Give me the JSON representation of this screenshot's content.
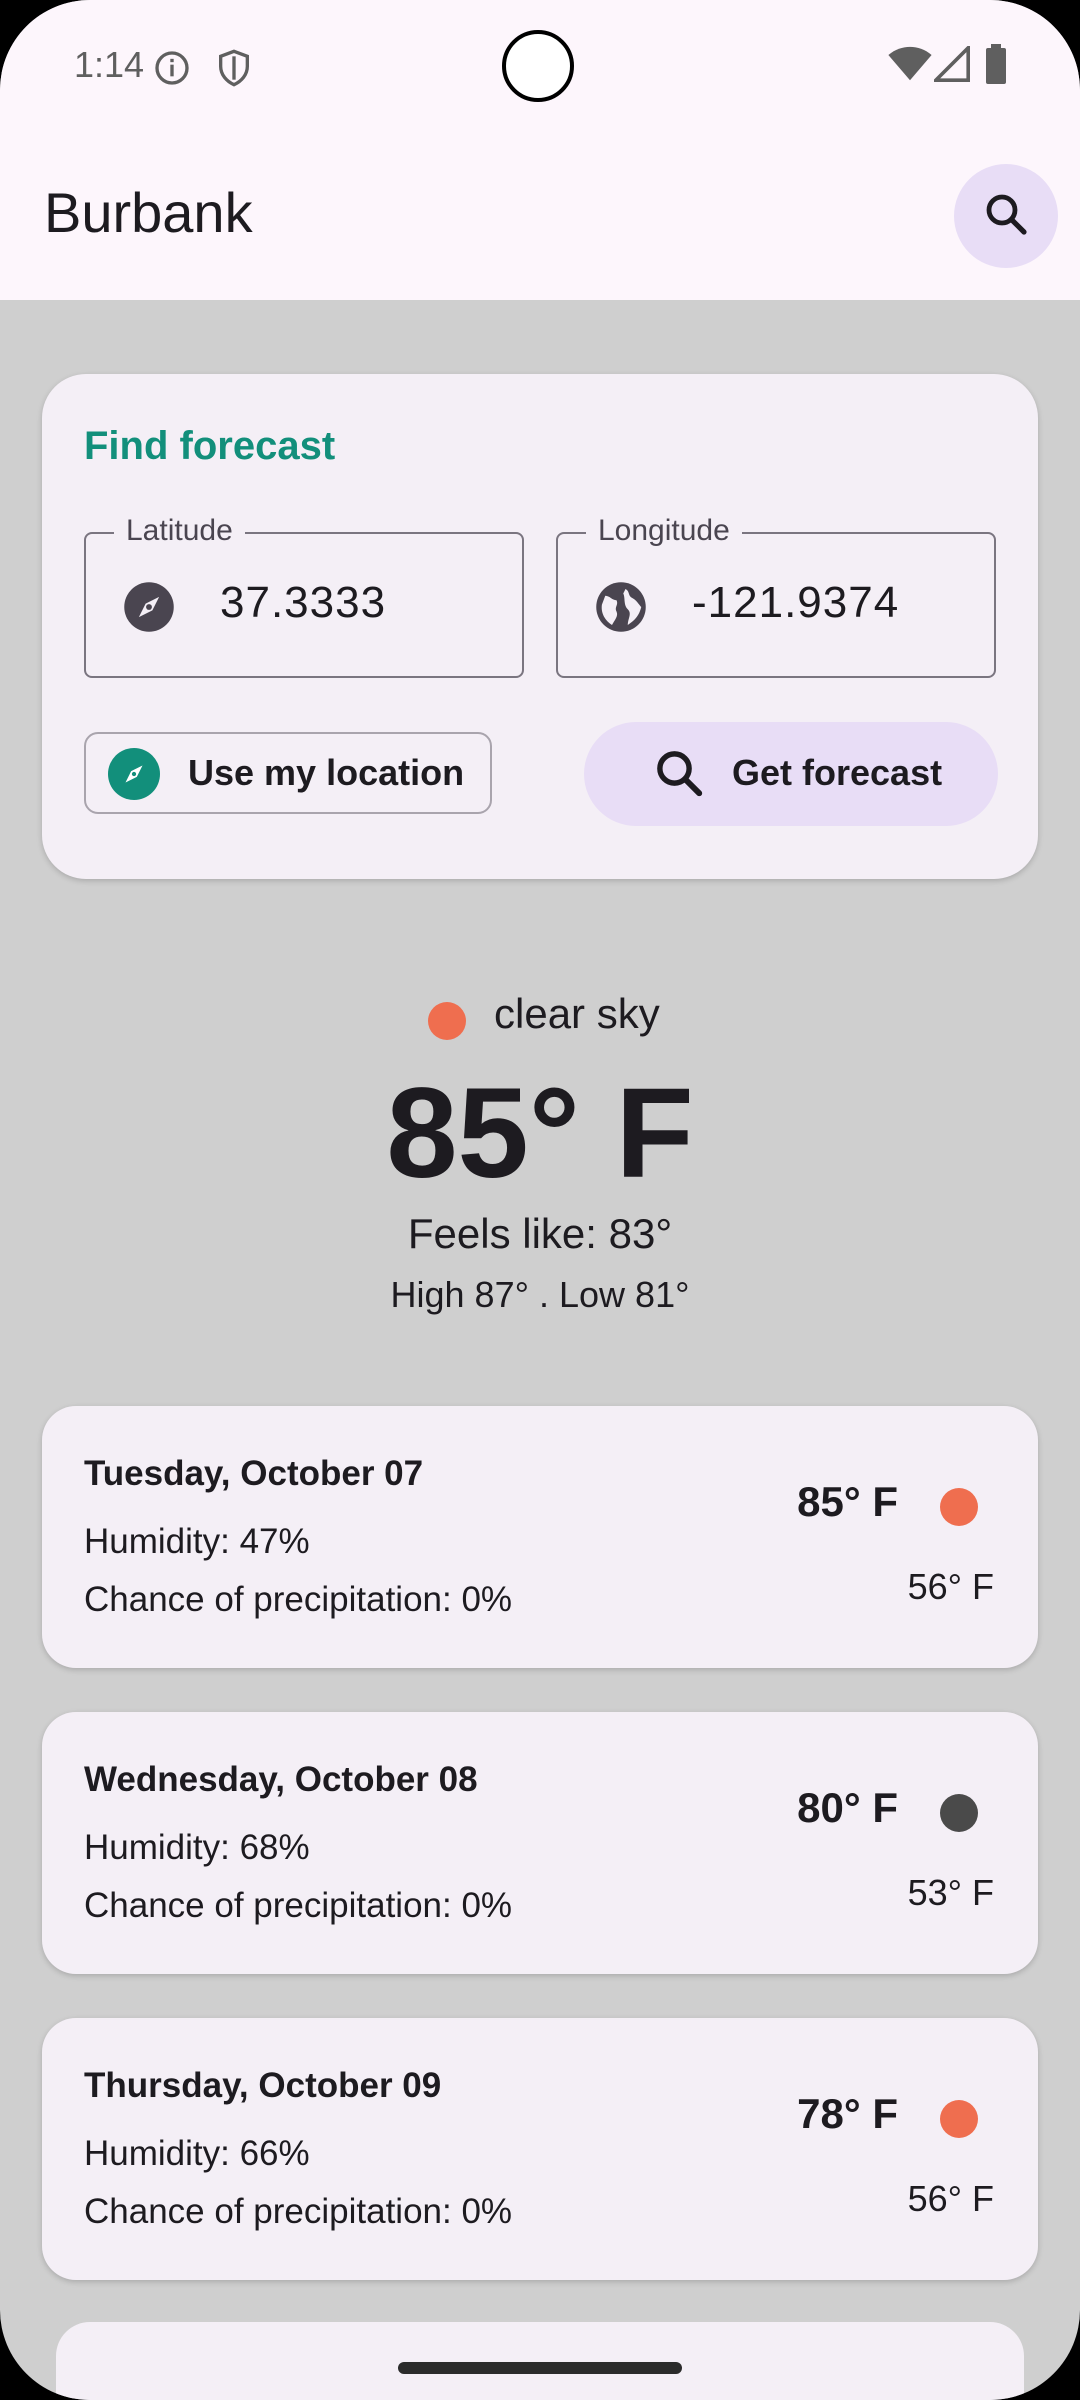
{
  "status_bar": {
    "time": "1:14"
  },
  "app_bar": {
    "title": "Burbank"
  },
  "find_forecast": {
    "title": "Find forecast",
    "latitude": {
      "label": "Latitude",
      "value": "37.3333"
    },
    "longitude": {
      "label": "Longitude",
      "value": "-121.9374"
    },
    "use_location_label": "Use my location",
    "get_forecast_label": "Get forecast"
  },
  "current": {
    "condition": "clear sky",
    "temperature": "85° F",
    "feels_like": "Feels like: 83°",
    "high_low": "High 87° . Low 81°",
    "condition_color": "#ef6e4f"
  },
  "days": [
    {
      "date": "Tuesday, October 07",
      "humidity": "Humidity: 47%",
      "precip": "Chance of precipitation: 0%",
      "high": "85° F",
      "low": "56° F",
      "color": "#ef6e4f"
    },
    {
      "date": "Wednesday, October 08",
      "humidity": "Humidity: 68%",
      "precip": "Chance of precipitation: 0%",
      "high": "80° F",
      "low": "53° F",
      "color": "#4a4a4a"
    },
    {
      "date": "Thursday, October 09",
      "humidity": "Humidity: 66%",
      "precip": "Chance of precipitation: 0%",
      "high": "78° F",
      "low": "56° F",
      "color": "#ef6e4f"
    }
  ],
  "colors": {
    "accent": "#128f7b",
    "surface": "#f4eff6",
    "tonal": "#e8ddf6",
    "background": "#cfcfcf"
  },
  "icons": [
    "info-icon",
    "shield-icon",
    "wifi-icon",
    "signal-icon",
    "battery-icon",
    "search-icon",
    "compass-icon",
    "globe-icon"
  ]
}
